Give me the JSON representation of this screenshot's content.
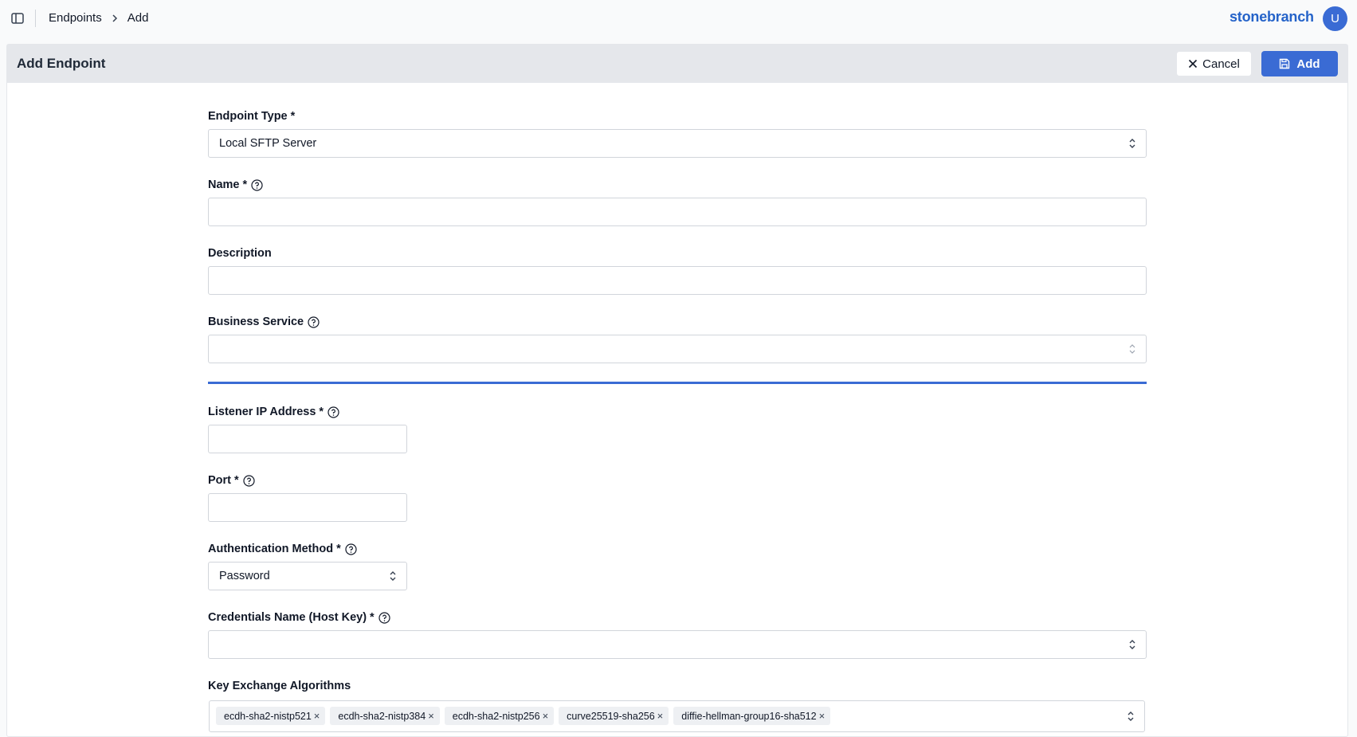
{
  "breadcrumb": {
    "root": "Endpoints",
    "current": "Add"
  },
  "brand": {
    "logo": "stonebranch",
    "color": "#2563c9"
  },
  "user": {
    "avatar_initial": "U"
  },
  "panel": {
    "title": "Add Endpoint",
    "cancel_label": "Cancel",
    "add_label": "Add"
  },
  "form": {
    "endpoint_type": {
      "label": "Endpoint Type *",
      "value": "Local SFTP Server"
    },
    "name": {
      "label": "Name *",
      "value": ""
    },
    "description": {
      "label": "Description",
      "value": ""
    },
    "business_service": {
      "label": "Business Service",
      "value": ""
    },
    "listener_ip": {
      "label": "Listener IP Address *",
      "value": ""
    },
    "port": {
      "label": "Port *",
      "value": ""
    },
    "auth_method": {
      "label": "Authentication Method *",
      "value": "Password"
    },
    "credentials_host_key": {
      "label": "Credentials Name (Host Key) *",
      "value": ""
    },
    "key_exchange": {
      "label": "Key Exchange Algorithms",
      "chips": [
        "ecdh-sha2-nistp521",
        "ecdh-sha2-nistp384",
        "ecdh-sha2-nistp256",
        "curve25519-sha256",
        "diffie-hellman-group16-sha512"
      ]
    }
  },
  "colors": {
    "accent": "#3a6bd4",
    "header_bg": "#e5e7eb"
  },
  "icons": {
    "sidebar_toggle": "sidebar-toggle-icon",
    "breadcrumb_sep": "chevron-right-icon",
    "cancel": "close-icon",
    "add": "save-icon",
    "help": "help-circle-icon",
    "select": "chevron-up-down-icon",
    "chip_remove": "close-icon"
  }
}
